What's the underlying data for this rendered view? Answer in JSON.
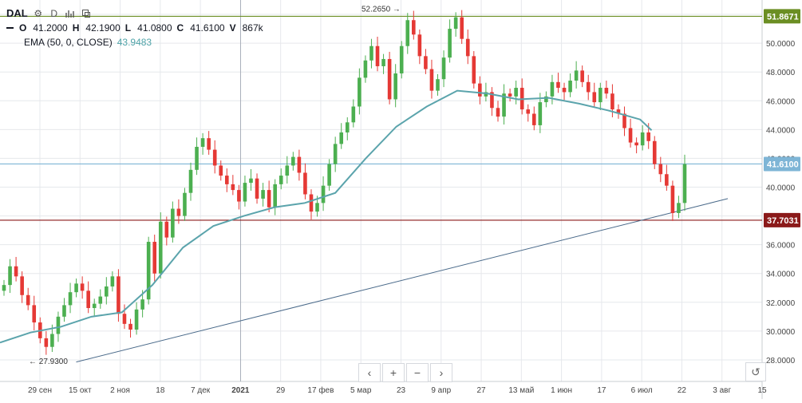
{
  "legend": {
    "symbol": "DAL",
    "interval": "D",
    "ohlc": [
      {
        "key": "O",
        "value": "41.2000"
      },
      {
        "key": "H",
        "value": "42.1900"
      },
      {
        "key": "L",
        "value": "41.0800"
      },
      {
        "key": "C",
        "value": "41.6100"
      },
      {
        "key": "V",
        "value": "867k"
      }
    ],
    "ema_label": "EMA (50, 0, CLOSE)",
    "ema_value": "43.9483",
    "icons": [
      "gear-icon",
      "bar-chart-icon",
      "compare-icon"
    ]
  },
  "colors": {
    "up": "#4caf50",
    "down": "#e53935",
    "ema": "#5ba4ac",
    "trendline": "#4a6a8a",
    "level_high": "#6b8e23",
    "level_low": "#8b1a1a",
    "level_current": "#7eb5d6",
    "grid": "#e6e8ec"
  },
  "nav_buttons": [
    "‹",
    "+",
    "−",
    "›"
  ],
  "reset_icon": "reset-icon",
  "chart_data": {
    "type": "candlestick",
    "y_ticks": [
      "52.0000",
      "50.0000",
      "48.0000",
      "46.0000",
      "44.0000",
      "42.0000",
      "40.0000",
      "38.0000",
      "36.0000",
      "34.0000",
      "32.0000",
      "30.0000",
      "28.0000"
    ],
    "y_range": [
      26.5,
      53.0
    ],
    "x_labels": [
      "29 сен",
      "15 окт",
      "2 ноя",
      "18",
      "7 дек",
      "2021",
      "29",
      "17 фев",
      "5 мар",
      "23",
      "9 апр",
      "27",
      "13 май",
      "1 июн",
      "17",
      "6 июл",
      "22",
      "3 авг",
      "15"
    ],
    "label_high": {
      "text": "51.8671",
      "value": 51.8671
    },
    "label_current": {
      "text": "41.6100",
      "value": 41.61
    },
    "label_low": {
      "text": "37.7031",
      "value": 37.7031
    },
    "annotation_high": {
      "text": "52.2650",
      "value": 52.265
    },
    "annotation_low": {
      "text": "27.9300",
      "value": 27.93
    },
    "trendline": {
      "from": [
        0.1,
        27.85
      ],
      "to": [
        0.955,
        39.2
      ]
    },
    "ema": [
      [
        0,
        29.2
      ],
      [
        0.04,
        29.9
      ],
      [
        0.08,
        30.3
      ],
      [
        0.12,
        31.0
      ],
      [
        0.16,
        31.3
      ],
      [
        0.2,
        33.2
      ],
      [
        0.24,
        35.8
      ],
      [
        0.28,
        37.3
      ],
      [
        0.32,
        38.0
      ],
      [
        0.36,
        38.6
      ],
      [
        0.4,
        38.9
      ],
      [
        0.44,
        39.6
      ],
      [
        0.48,
        42.0
      ],
      [
        0.52,
        44.2
      ],
      [
        0.56,
        45.6
      ],
      [
        0.6,
        46.7
      ],
      [
        0.64,
        46.5
      ],
      [
        0.68,
        46.1
      ],
      [
        0.72,
        46.2
      ],
      [
        0.76,
        45.8
      ],
      [
        0.8,
        45.3
      ],
      [
        0.84,
        44.7
      ],
      [
        0.855,
        43.95
      ]
    ],
    "closes": [
      33.2,
      34.5,
      33.8,
      32.5,
      31.8,
      30.6,
      29.5,
      28.9,
      29.8,
      31.0,
      31.8,
      32.7,
      33.3,
      32.8,
      31.6,
      31.9,
      32.4,
      33.1,
      33.8,
      31.2,
      30.5,
      30.1,
      31.5,
      32.2,
      36.2,
      34.0,
      37.6,
      36.5,
      38.5,
      38.0,
      39.6,
      41.2,
      42.8,
      43.4,
      42.6,
      41.5,
      40.8,
      40.2,
      39.8,
      39.0,
      40.3,
      40.6,
      39.2,
      39.8,
      38.6,
      40.2,
      40.8,
      41.5,
      42.1,
      41.0,
      39.5,
      38.3,
      38.9,
      40.1,
      41.6,
      43.0,
      43.8,
      44.5,
      45.6,
      47.6,
      48.8,
      49.8,
      48.4,
      48.9,
      46.1,
      47.9,
      49.8,
      51.6,
      50.6,
      49.1,
      48.2,
      46.7,
      47.5,
      49.0,
      51.0,
      51.8,
      50.3,
      49.1,
      47.2,
      46.3,
      46.6,
      45.5,
      44.9,
      46.5,
      46.3,
      46.9,
      45.4,
      45.1,
      44.3,
      45.9,
      46.3,
      47.3,
      46.9,
      46.6,
      47.4,
      48.1,
      47.3,
      46.6,
      45.9,
      46.9,
      46.5,
      45.4,
      45.1,
      44.1,
      43.1,
      42.9,
      43.8,
      43.2,
      41.6,
      40.9,
      40.1,
      38.2,
      38.9,
      41.6
    ]
  }
}
